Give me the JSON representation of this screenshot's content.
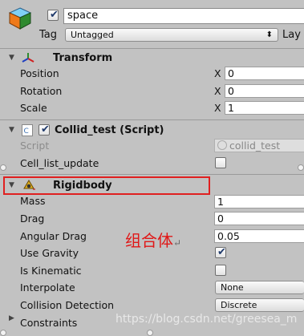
{
  "header": {
    "object_name": "space",
    "tag_label": "Tag",
    "tag_value": "Untagged",
    "layer_label": "Lay"
  },
  "transform": {
    "title": "Transform",
    "rows": [
      {
        "label": "Position",
        "axis": "X",
        "value": "0"
      },
      {
        "label": "Rotation",
        "axis": "X",
        "value": "0"
      },
      {
        "label": "Scale",
        "axis": "X",
        "value": "1"
      }
    ]
  },
  "script_component": {
    "title": "Collid_test (Script)",
    "script_label": "Script",
    "script_value": "collid_test",
    "cell_label": "Cell_list_update"
  },
  "rigidbody": {
    "title": "Rigidbody",
    "mass_label": "Mass",
    "mass_value": "1",
    "drag_label": "Drag",
    "drag_value": "0",
    "angular_drag_label": "Angular Drag",
    "angular_drag_value": "0.05",
    "use_gravity_label": "Use Gravity",
    "is_kinematic_label": "Is Kinematic",
    "interpolate_label": "Interpolate",
    "interpolate_value": "None",
    "collision_label": "Collision Detection",
    "collision_value": "Discrete",
    "constraints_label": "Constraints"
  },
  "annotation": {
    "text": "组合体"
  },
  "watermark": "https://blog.csdn.net/greesea_m",
  "colors": {
    "highlight": "#e02020",
    "annotation": "#e01818",
    "panel_bg": "#c2c2c2"
  },
  "icons": [
    "gameobject-cube-icon",
    "transform-axes-icon",
    "script-icon",
    "rigidbody-icon",
    "foldout-arrow-icon"
  ]
}
